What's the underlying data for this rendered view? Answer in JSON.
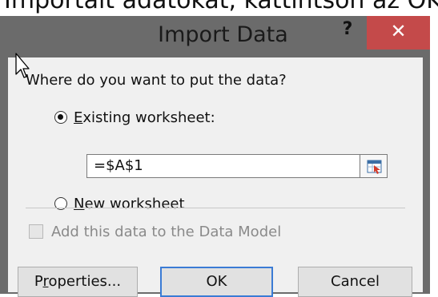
{
  "page": {
    "background_text": "Importált adatokat, kattintson az OK gom"
  },
  "dialog": {
    "title": "Import Data",
    "help_glyph": "?",
    "close_glyph": "✕",
    "question": "Where do you want to put the data?",
    "options": [
      {
        "label_prefix": "",
        "label_underlined": "E",
        "label_rest": "xisting worksheet:",
        "checked": true
      },
      {
        "label_prefix": "",
        "label_underlined": "N",
        "label_rest": "ew worksheet",
        "checked": false
      }
    ],
    "range_value": "=$A$1",
    "data_model_label": "Add this data to the Data Model",
    "buttons": {
      "properties": {
        "prefix": "P",
        "underlined": "r",
        "rest": "operties..."
      },
      "ok": "OK",
      "cancel": "Cancel"
    }
  },
  "colors": {
    "titlebar": "#6b6b6b",
    "close_button": "#c44a4a",
    "client": "#f0f0f0",
    "focus_border": "#3a7bd5"
  },
  "icons": {
    "cursor": "mouse-pointer-icon",
    "range_selector": "collapse-dialog-icon"
  }
}
